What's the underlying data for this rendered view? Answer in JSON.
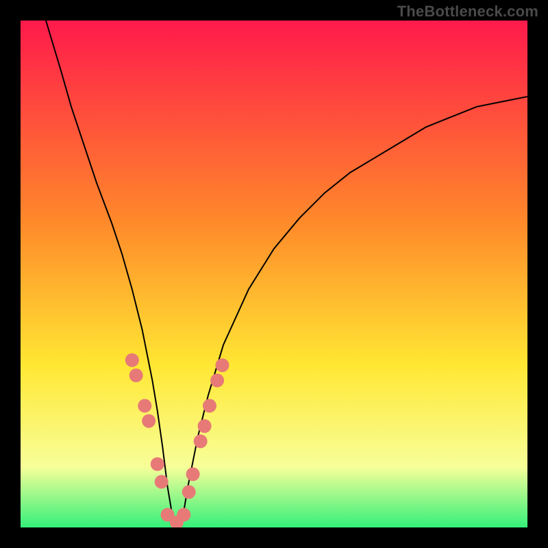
{
  "watermark": "TheBottleneck.com",
  "colors": {
    "background": "#000000",
    "gradient_top": "#ff1a4b",
    "gradient_mid1": "#ff8a2a",
    "gradient_mid2": "#ffe733",
    "gradient_mid3": "#f8ff99",
    "gradient_bottom": "#34f07a",
    "curve": "#000000",
    "dot": "#e77a77"
  },
  "chart_data": {
    "type": "line",
    "title": "",
    "xlabel": "",
    "ylabel": "",
    "xlim": [
      0,
      100
    ],
    "ylim": [
      0,
      100
    ],
    "series": [
      {
        "name": "bottleneck-curve",
        "x": [
          5,
          8,
          10,
          12,
          15,
          18,
          20,
          22,
          24,
          26,
          27,
          28,
          29,
          30,
          31,
          32,
          33,
          35,
          37,
          40,
          45,
          50,
          55,
          60,
          65,
          70,
          75,
          80,
          85,
          90,
          95,
          100
        ],
        "y": [
          100,
          90,
          83,
          77,
          68,
          60,
          54,
          47,
          39,
          29,
          23,
          16,
          8,
          2,
          1,
          2,
          8,
          18,
          26,
          36,
          47,
          55,
          61,
          66,
          70,
          73,
          76,
          79,
          81,
          83,
          84,
          85
        ]
      }
    ],
    "dots": {
      "name": "highlight-dots",
      "points": [
        {
          "x": 22.0,
          "y": 33.0
        },
        {
          "x": 22.8,
          "y": 30.0
        },
        {
          "x": 24.5,
          "y": 24.0
        },
        {
          "x": 25.3,
          "y": 21.0
        },
        {
          "x": 27.0,
          "y": 12.5
        },
        {
          "x": 27.8,
          "y": 9.0
        },
        {
          "x": 29.0,
          "y": 2.5
        },
        {
          "x": 30.8,
          "y": 1.0
        },
        {
          "x": 32.2,
          "y": 2.5
        },
        {
          "x": 33.2,
          "y": 7.0
        },
        {
          "x": 34.0,
          "y": 10.5
        },
        {
          "x": 35.5,
          "y": 17.0
        },
        {
          "x": 36.3,
          "y": 20.0
        },
        {
          "x": 37.3,
          "y": 24.0
        },
        {
          "x": 38.8,
          "y": 29.0
        },
        {
          "x": 39.8,
          "y": 32.0
        }
      ]
    }
  }
}
